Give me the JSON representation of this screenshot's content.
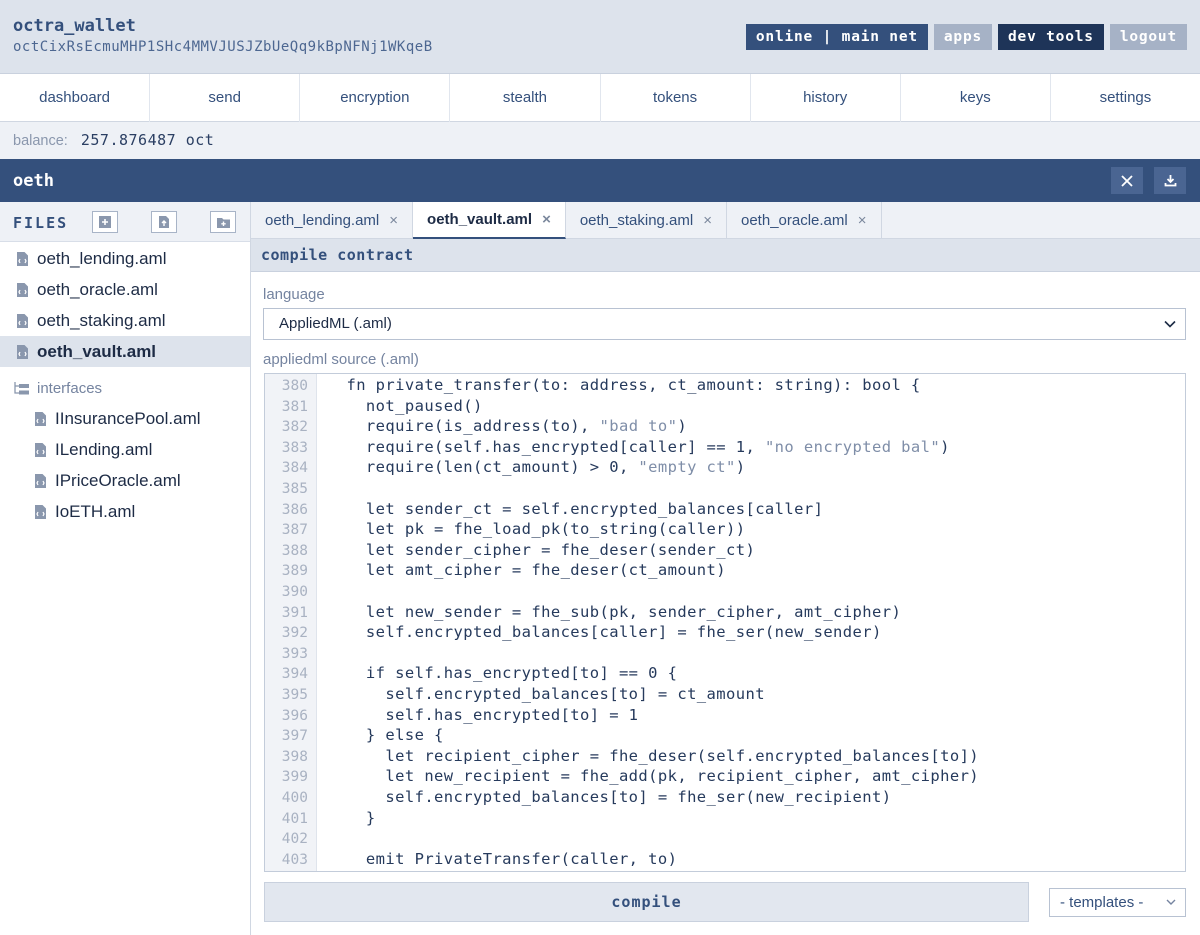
{
  "header": {
    "brand": "octra_wallet",
    "address": "octCixRsEcmuMHP1SHc4MMVJUSJZbUeQq9kBpNFNj1WKqeB",
    "buttons": {
      "network": "online | main net",
      "apps": "apps",
      "dev_tools": "dev tools",
      "logout": "logout"
    }
  },
  "nav": [
    "dashboard",
    "send",
    "encryption",
    "stealth",
    "tokens",
    "history",
    "keys",
    "settings"
  ],
  "balance": {
    "label": "balance:",
    "value": "257.876487 oct"
  },
  "project": {
    "title": "oeth"
  },
  "sidebar": {
    "title": "FILES",
    "files": [
      "oeth_lending.aml",
      "oeth_oracle.aml",
      "oeth_staking.aml",
      "oeth_vault.aml"
    ],
    "active_file": "oeth_vault.aml",
    "folder": "interfaces",
    "interface_files": [
      "IInsurancePool.aml",
      "ILending.aml",
      "IPriceOracle.aml",
      "IoETH.aml"
    ]
  },
  "tabs": [
    {
      "label": "oeth_lending.aml",
      "close": "×"
    },
    {
      "label": "oeth_vault.aml",
      "close": "×"
    },
    {
      "label": "oeth_staking.aml",
      "close": "×"
    },
    {
      "label": "oeth_oracle.aml",
      "close": "×"
    }
  ],
  "compile": {
    "heading": "compile contract",
    "language_label": "language",
    "language_value": "AppliedML (.aml)",
    "source_label": "appliedml source (.aml)",
    "button": "compile",
    "templates": "- templates -"
  },
  "editor": {
    "line_numbers": [
      "380",
      "381",
      "382",
      "383",
      "384",
      "385",
      "386",
      "387",
      "388",
      "389",
      "390",
      "391",
      "392",
      "393",
      "394",
      "395",
      "396",
      "397",
      "398",
      "399",
      "400",
      "401",
      "402",
      "403"
    ],
    "lines": [
      "  fn private_transfer(to: address, ct_amount: string): bool {",
      "    not_paused()",
      "    require(is_address(to), \"bad to\")",
      "    require(self.has_encrypted[caller] == 1, \"no encrypted bal\")",
      "    require(len(ct_amount) > 0, \"empty ct\")",
      "",
      "    let sender_ct = self.encrypted_balances[caller]",
      "    let pk = fhe_load_pk(to_string(caller))",
      "    let sender_cipher = fhe_deser(sender_ct)",
      "    let amt_cipher = fhe_deser(ct_amount)",
      "",
      "    let new_sender = fhe_sub(pk, sender_cipher, amt_cipher)",
      "    self.encrypted_balances[caller] = fhe_ser(new_sender)",
      "",
      "    if self.has_encrypted[to] == 0 {",
      "      self.encrypted_balances[to] = ct_amount",
      "      self.has_encrypted[to] = 1",
      "    } else {",
      "      let recipient_cipher = fhe_deser(self.encrypted_balances[to])",
      "      let new_recipient = fhe_add(pk, recipient_cipher, amt_cipher)",
      "      self.encrypted_balances[to] = fhe_ser(new_recipient)",
      "    }",
      "",
      "    emit PrivateTransfer(caller, to)"
    ]
  }
}
